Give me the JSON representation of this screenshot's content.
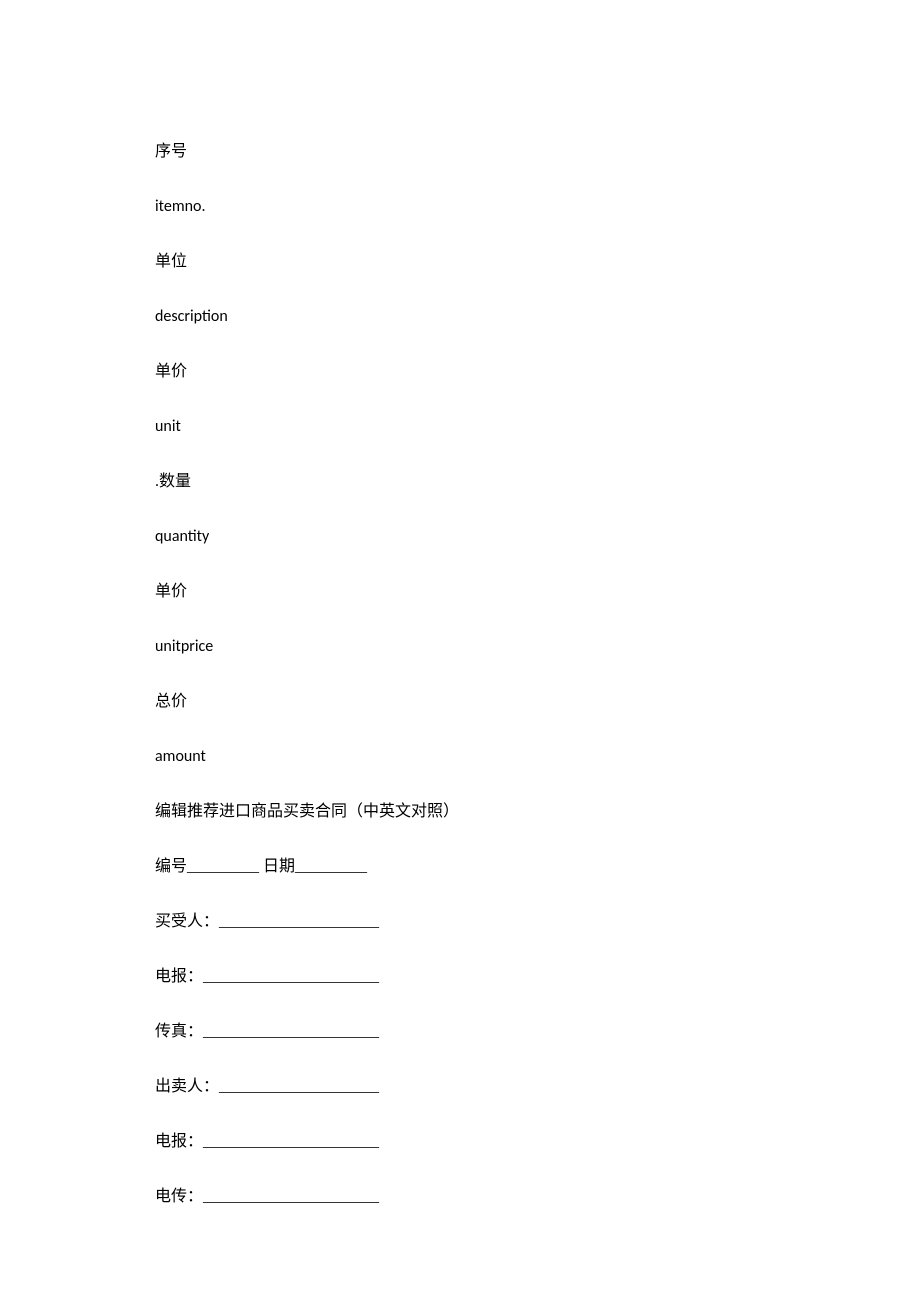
{
  "lines": {
    "l1": "序号",
    "l2": "itemno.",
    "l3": "单位",
    "l4": "description",
    "l5": "单价",
    "l6": "unit",
    "l7": ".数量",
    "l8": "quantity",
    "l9": "单价",
    "l10": "unitprice",
    "l11": "总价",
    "l12": "amount",
    "l13": "编辑推荐进口商品买卖合同（中英文对照）",
    "l14": "编号_________  日期_________",
    "l15": "买受人：____________________",
    "l16": "电报：______________________",
    "l17": "传真：______________________",
    "l18": "出卖人：____________________",
    "l19": "电报：______________________",
    "l20": "电传：______________________"
  }
}
